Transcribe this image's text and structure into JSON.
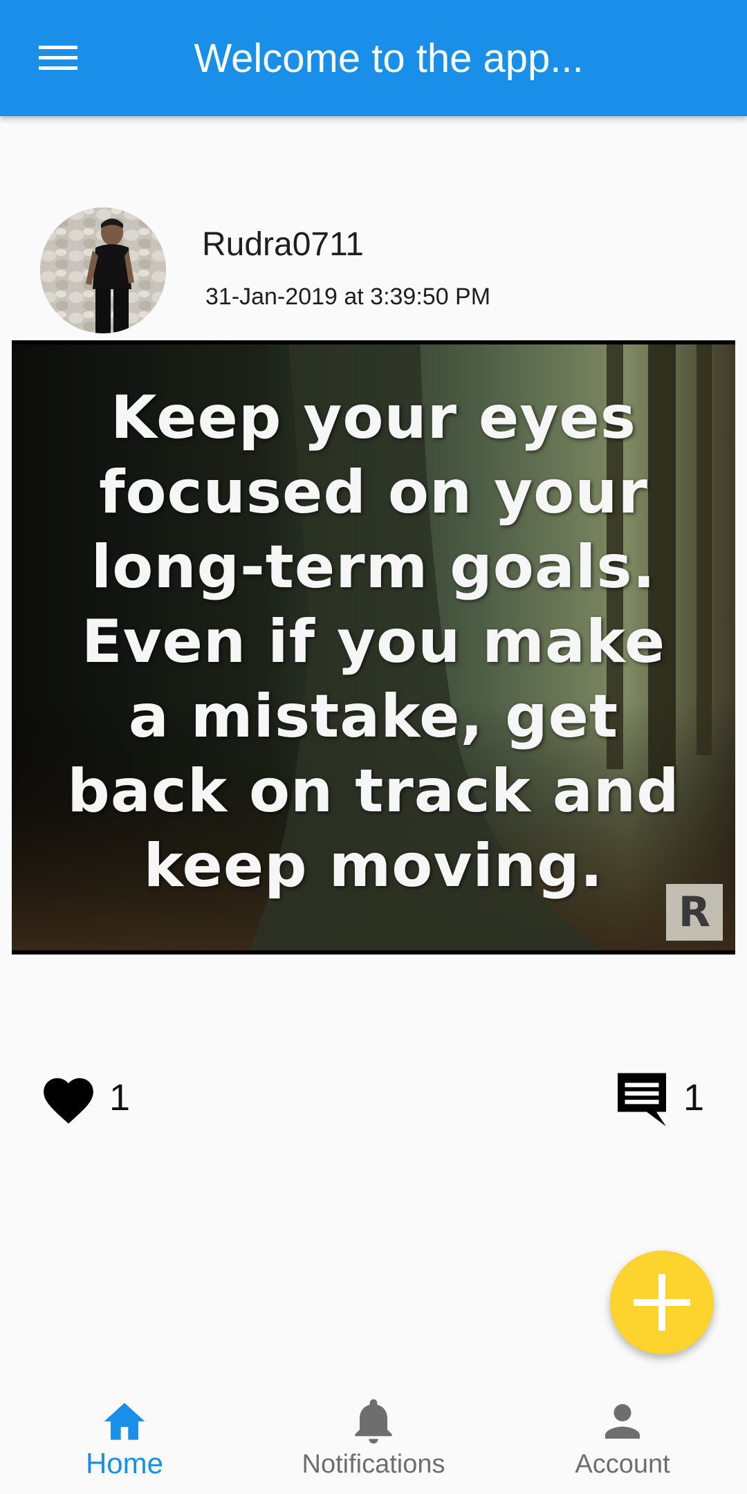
{
  "appbar": {
    "title": "Welcome to the app...",
    "menu_icon": "menu-icon",
    "color": "#1a8fea"
  },
  "post": {
    "username": "Rudra0711",
    "timestamp": "31-Jan-2019 at 3:39:50 PM",
    "image_text": "Keep your eyes\nfocused on your\nlong-term goals.\nEven if you make\na mistake, get\nback on track and\nkeep moving.",
    "watermark": "R",
    "likes": "1",
    "comments": "1"
  },
  "fab": {
    "icon": "plus-icon",
    "color": "#fdd32e"
  },
  "bottom_nav": {
    "items": [
      {
        "label": "Home",
        "icon": "home-icon",
        "active": true
      },
      {
        "label": "Notifications",
        "icon": "bell-icon",
        "active": false
      },
      {
        "label": "Account",
        "icon": "person-icon",
        "active": false
      }
    ],
    "active_color": "#1a8fea",
    "inactive_color": "#6e6e6e"
  }
}
